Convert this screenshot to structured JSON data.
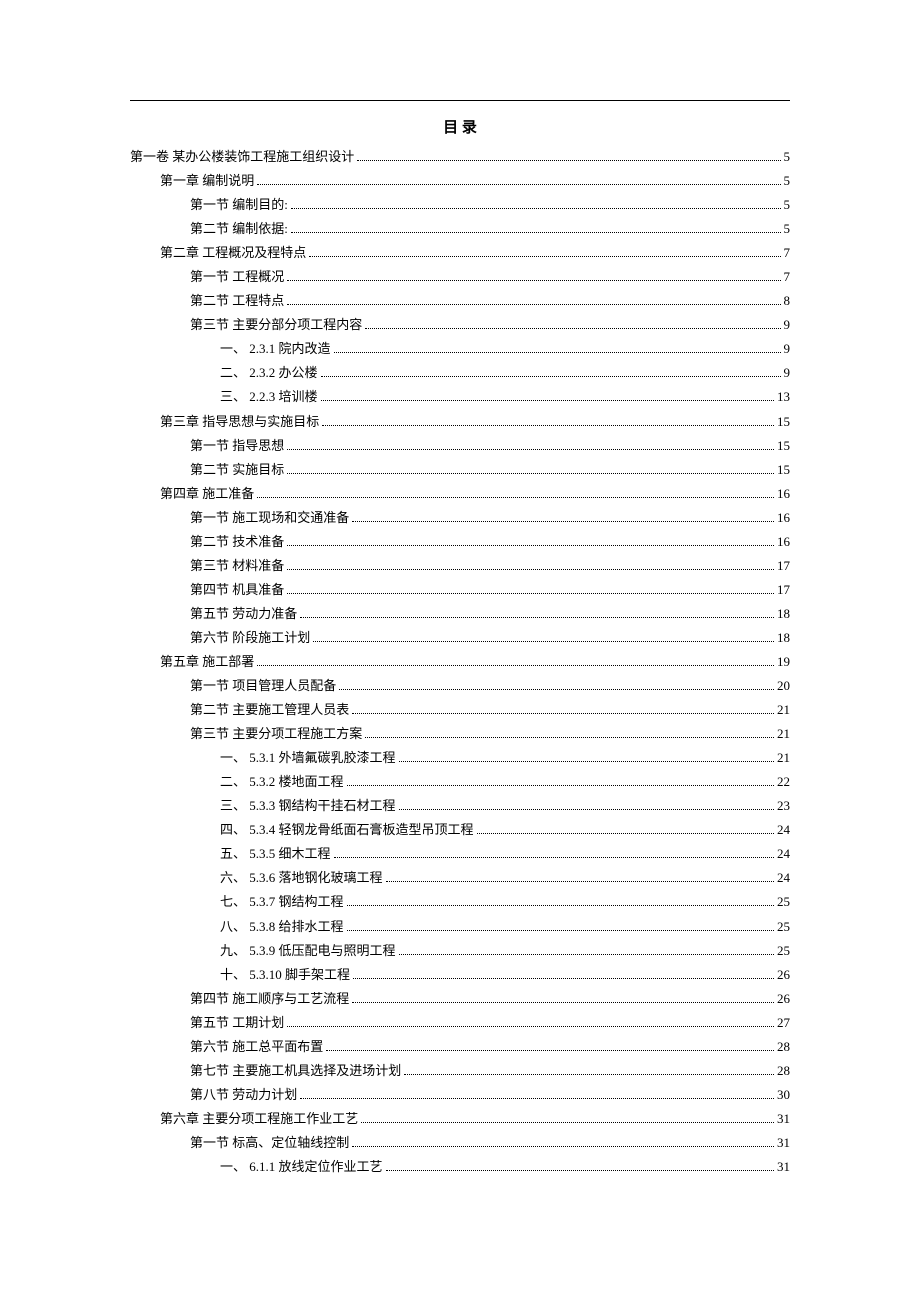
{
  "title": "目 录",
  "entries": [
    {
      "level": 0,
      "text": "第一卷 某办公楼装饰工程施工组织设计",
      "page": "5"
    },
    {
      "level": 1,
      "text": "第一章 编制说明",
      "page": "5"
    },
    {
      "level": 2,
      "text": "第一节 编制目的:",
      "page": "5"
    },
    {
      "level": 2,
      "text": "第二节 编制依据:",
      "page": "5"
    },
    {
      "level": 1,
      "text": "第二章 工程概况及程特点",
      "page": "7"
    },
    {
      "level": 2,
      "text": "第一节 工程概况",
      "page": "7"
    },
    {
      "level": 2,
      "text": "第二节 工程特点",
      "page": "8"
    },
    {
      "level": 2,
      "text": "第三节 主要分部分项工程内容",
      "page": "9"
    },
    {
      "level": 3,
      "text": "一、 2.3.1 院内改造",
      "page": "9"
    },
    {
      "level": 3,
      "text": "二、 2.3.2 办公楼",
      "page": "9"
    },
    {
      "level": 3,
      "text": "三、 2.2.3 培训楼",
      "page": "13"
    },
    {
      "level": 1,
      "text": "第三章 指导思想与实施目标",
      "page": "15"
    },
    {
      "level": 2,
      "text": "第一节 指导思想",
      "page": "15"
    },
    {
      "level": 2,
      "text": "第二节 实施目标",
      "page": "15"
    },
    {
      "level": 1,
      "text": "第四章 施工准备",
      "page": "16"
    },
    {
      "level": 2,
      "text": "第一节 施工现场和交通准备",
      "page": "16"
    },
    {
      "level": 2,
      "text": "第二节 技术准备",
      "page": "16"
    },
    {
      "level": 2,
      "text": "第三节 材料准备",
      "page": "17"
    },
    {
      "level": 2,
      "text": "第四节 机具准备",
      "page": "17"
    },
    {
      "level": 2,
      "text": "第五节 劳动力准备",
      "page": "18"
    },
    {
      "level": 2,
      "text": "第六节 阶段施工计划",
      "page": "18"
    },
    {
      "level": 1,
      "text": "第五章 施工部署",
      "page": "19"
    },
    {
      "level": 2,
      "text": "第一节 项目管理人员配备",
      "page": "20"
    },
    {
      "level": 2,
      "text": "第二节 主要施工管理人员表",
      "page": "21"
    },
    {
      "level": 2,
      "text": "第三节 主要分项工程施工方案",
      "page": "21"
    },
    {
      "level": 3,
      "text": "一、 5.3.1 外墙氟碳乳胶漆工程",
      "page": "21"
    },
    {
      "level": 3,
      "text": "二、 5.3.2 楼地面工程",
      "page": "22"
    },
    {
      "level": 3,
      "text": "三、 5.3.3 钢结构干挂石材工程",
      "page": "23"
    },
    {
      "level": 3,
      "text": "四、 5.3.4 轻钢龙骨纸面石膏板造型吊顶工程",
      "page": "24"
    },
    {
      "level": 3,
      "text": "五、 5.3.5 细木工程",
      "page": "24"
    },
    {
      "level": 3,
      "text": "六、 5.3.6 落地钢化玻璃工程",
      "page": "24"
    },
    {
      "level": 3,
      "text": "七、 5.3.7 钢结构工程",
      "page": "25"
    },
    {
      "level": 3,
      "text": "八、 5.3.8 给排水工程",
      "page": "25"
    },
    {
      "level": 3,
      "text": "九、 5.3.9 低压配电与照明工程",
      "page": "25"
    },
    {
      "level": 3,
      "text": "十、 5.3.10 脚手架工程",
      "page": "26"
    },
    {
      "level": 2,
      "text": "第四节 施工顺序与工艺流程",
      "page": "26"
    },
    {
      "level": 2,
      "text": "第五节 工期计划",
      "page": "27"
    },
    {
      "level": 2,
      "text": "第六节 施工总平面布置",
      "page": "28"
    },
    {
      "level": 2,
      "text": "第七节 主要施工机具选择及进场计划",
      "page": "28"
    },
    {
      "level": 2,
      "text": "第八节 劳动力计划",
      "page": "30"
    },
    {
      "level": 1,
      "text": "第六章 主要分项工程施工作业工艺",
      "page": "31"
    },
    {
      "level": 2,
      "text": "第一节 标高、定位轴线控制",
      "page": "31"
    },
    {
      "level": 3,
      "text": "一、 6.1.1 放线定位作业工艺",
      "page": "31"
    }
  ]
}
